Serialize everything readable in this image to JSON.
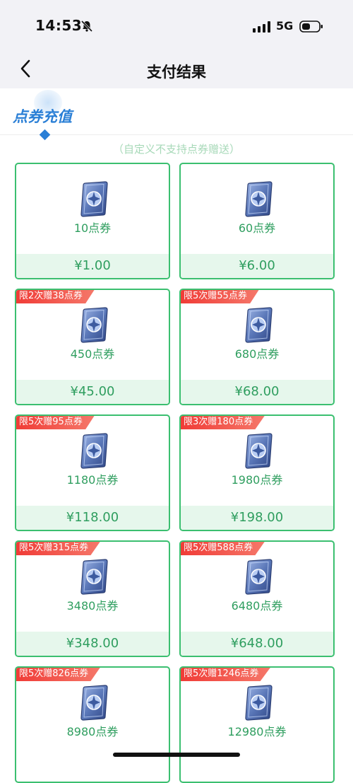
{
  "status": {
    "time": "14:53",
    "network": "5G"
  },
  "nav": {
    "title": "支付结果"
  },
  "tab": {
    "label": "点券充值"
  },
  "note": "（自定义不支持点券赠送）",
  "colors": {
    "accent": "#2a7fd6",
    "green": "#3bbf70",
    "badge_red": "#f03b36"
  },
  "packages": [
    {
      "name": "10点券",
      "price": "¥1.00",
      "badge": ""
    },
    {
      "name": "60点券",
      "price": "¥6.00",
      "badge": ""
    },
    {
      "name": "450点券",
      "price": "¥45.00",
      "badge": "限2次赠38点券"
    },
    {
      "name": "680点券",
      "price": "¥68.00",
      "badge": "限5次赠55点券"
    },
    {
      "name": "1180点券",
      "price": "¥118.00",
      "badge": "限5次赠95点券"
    },
    {
      "name": "1980点券",
      "price": "¥198.00",
      "badge": "限3次赠180点券"
    },
    {
      "name": "3480点券",
      "price": "¥348.00",
      "badge": "限5次赠315点券"
    },
    {
      "name": "6480点券",
      "price": "¥648.00",
      "badge": "限5次赠588点券"
    },
    {
      "name": "8980点券",
      "price": "",
      "badge": "限5次赠826点券"
    },
    {
      "name": "12980点券",
      "price": "",
      "badge": "限5次赠1246点券"
    }
  ]
}
